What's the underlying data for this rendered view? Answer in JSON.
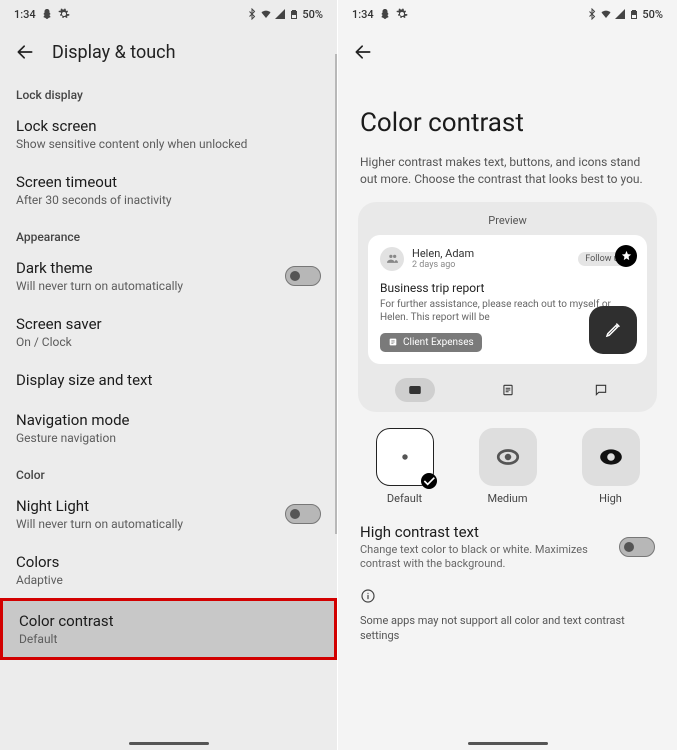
{
  "status": {
    "time": "1:34",
    "battery": "50%"
  },
  "left": {
    "title": "Display & touch",
    "sections": {
      "lock": "Lock display",
      "appearance": "Appearance",
      "color": "Color"
    },
    "rows": {
      "lock_screen": {
        "t": "Lock screen",
        "s": "Show sensitive content only when unlocked"
      },
      "screen_timeout": {
        "t": "Screen timeout",
        "s": "After 30 seconds of inactivity"
      },
      "dark_theme": {
        "t": "Dark theme",
        "s": "Will never turn on automatically"
      },
      "screen_saver": {
        "t": "Screen saver",
        "s": "On / Clock"
      },
      "display_size": {
        "t": "Display size and text"
      },
      "nav_mode": {
        "t": "Navigation mode",
        "s": "Gesture navigation"
      },
      "night_light": {
        "t": "Night Light",
        "s": "Will never turn on automatically"
      },
      "colors": {
        "t": "Colors",
        "s": "Adaptive"
      },
      "color_contrast": {
        "t": "Color contrast",
        "s": "Default"
      }
    }
  },
  "right": {
    "title": "Color contrast",
    "desc": "Higher contrast makes text, buttons, and icons stand out more. Choose the contrast that looks best to you.",
    "preview": {
      "label": "Preview",
      "sender": "Helen, Adam",
      "time": "2 days ago",
      "tag": "Follow up?",
      "subject": "Business trip report",
      "body": "For further assistance, please reach out to myself or Helen. This report will be",
      "chip": "Client Expenses"
    },
    "options": {
      "default": "Default",
      "medium": "Medium",
      "high": "High"
    },
    "hct": {
      "t": "High contrast text",
      "s": "Change text color to black or white. Maximizes contrast with the background."
    },
    "note": "Some apps may not support all color and text contrast settings"
  }
}
